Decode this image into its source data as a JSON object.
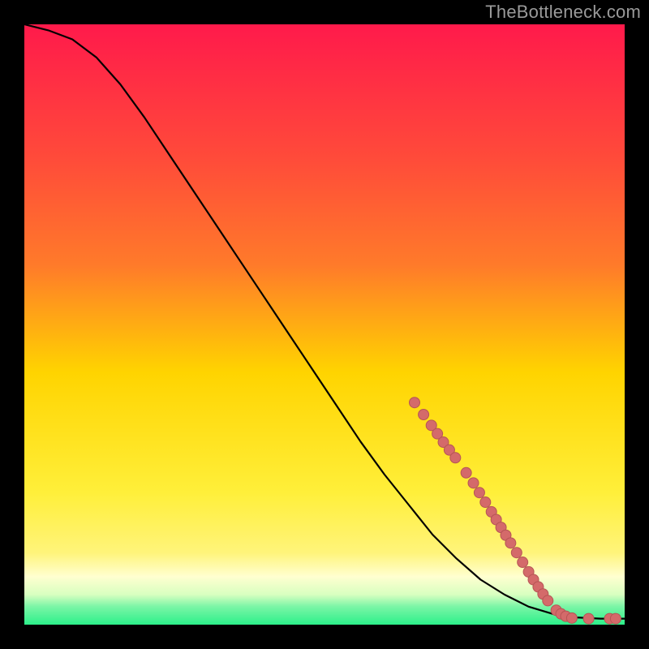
{
  "watermark": "TheBottleneck.com",
  "colors": {
    "gradient_top": "#ff1a4b",
    "gradient_q1": "#ff7a2a",
    "gradient_mid": "#ffd400",
    "gradient_q3": "#fff47a",
    "gradient_lowpale": "#ffffd0",
    "gradient_green": "#2cf08a",
    "curve": "#000000",
    "dot_fill": "#d46a6a",
    "dot_stroke": "#b65555",
    "frame_bg": "#000000"
  },
  "chart_data": {
    "type": "line",
    "title": "",
    "xlabel": "",
    "ylabel": "",
    "xlim": [
      0,
      100
    ],
    "ylim": [
      0,
      100
    ],
    "grid": false,
    "legend": false,
    "series": [
      {
        "name": "bottleneck-curve",
        "x": [
          0,
          4,
          8,
          12,
          16,
          20,
          24,
          28,
          32,
          36,
          40,
          44,
          48,
          52,
          56,
          60,
          64,
          68,
          72,
          76,
          80,
          84,
          88,
          92,
          96,
          100
        ],
        "y": [
          100,
          99,
          97.5,
          94.5,
          90,
          84.5,
          78.5,
          72.5,
          66.5,
          60.5,
          54.5,
          48.5,
          42.5,
          36.5,
          30.5,
          25,
          20,
          15,
          11,
          7.5,
          5,
          3,
          1.8,
          1.2,
          1,
          1
        ]
      }
    ],
    "points": [
      {
        "name": "p1",
        "x": 65.0,
        "y": 37.0
      },
      {
        "name": "p2",
        "x": 66.5,
        "y": 35.0
      },
      {
        "name": "p3",
        "x": 67.8,
        "y": 33.2
      },
      {
        "name": "p4",
        "x": 68.8,
        "y": 31.8
      },
      {
        "name": "p5",
        "x": 69.8,
        "y": 30.4
      },
      {
        "name": "p6",
        "x": 70.8,
        "y": 29.1
      },
      {
        "name": "p7",
        "x": 71.8,
        "y": 27.8
      },
      {
        "name": "p8",
        "x": 73.6,
        "y": 25.3
      },
      {
        "name": "p9",
        "x": 74.8,
        "y": 23.6
      },
      {
        "name": "p10",
        "x": 75.8,
        "y": 22.0
      },
      {
        "name": "p11",
        "x": 76.8,
        "y": 20.4
      },
      {
        "name": "p12",
        "x": 77.8,
        "y": 18.8
      },
      {
        "name": "p13",
        "x": 78.6,
        "y": 17.5
      },
      {
        "name": "p14",
        "x": 79.4,
        "y": 16.2
      },
      {
        "name": "p15",
        "x": 80.2,
        "y": 14.9
      },
      {
        "name": "p16",
        "x": 81.0,
        "y": 13.6
      },
      {
        "name": "p17",
        "x": 82.0,
        "y": 12.0
      },
      {
        "name": "p18",
        "x": 83.0,
        "y": 10.4
      },
      {
        "name": "p19",
        "x": 84.0,
        "y": 8.8
      },
      {
        "name": "p20",
        "x": 84.8,
        "y": 7.5
      },
      {
        "name": "p21",
        "x": 85.6,
        "y": 6.3
      },
      {
        "name": "p22",
        "x": 86.4,
        "y": 5.1
      },
      {
        "name": "p23",
        "x": 87.2,
        "y": 4.0
      },
      {
        "name": "p24",
        "x": 88.6,
        "y": 2.4
      },
      {
        "name": "p25",
        "x": 89.4,
        "y": 1.8
      },
      {
        "name": "p26",
        "x": 90.2,
        "y": 1.4
      },
      {
        "name": "p27",
        "x": 91.2,
        "y": 1.1
      },
      {
        "name": "p28",
        "x": 94.0,
        "y": 1.0
      },
      {
        "name": "p29",
        "x": 97.5,
        "y": 1.0
      },
      {
        "name": "p30",
        "x": 98.5,
        "y": 1.0
      }
    ]
  }
}
